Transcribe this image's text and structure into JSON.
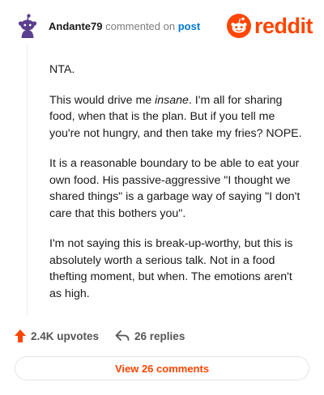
{
  "comment": {
    "username": "Andante79",
    "action_text": "commented on",
    "post_link": "post",
    "paragraphs": [
      {
        "before": "NTA.",
        "em": "",
        "after": ""
      },
      {
        "before": "This would drive me ",
        "em": "insane",
        "after": ". I'm all for sharing food, when that is the plan. But if you tell me you're not hungry, and then take my fries? NOPE."
      },
      {
        "before": "It is a reasonable boundary to be able to eat your own food. His passive-aggressive \"I thought we shared things\" is a garbage way of saying \"I don't care that this bothers you\".",
        "em": "",
        "after": ""
      },
      {
        "before": "I'm not saying this is break-up-worthy, but this is absolutely worth a serious talk. Not in a food thefting moment, but when. The emotions aren't as high.",
        "em": "",
        "after": ""
      }
    ]
  },
  "logo": {
    "text": "reddit",
    "icon": "reddit-snoo-icon"
  },
  "actions": {
    "upvotes": "2.4K upvotes",
    "replies": "26 replies"
  },
  "view_button": "View 26 comments",
  "colors": {
    "brand": "#ff4500",
    "link": "#0079d3",
    "avatar": "#5b3f8f"
  }
}
